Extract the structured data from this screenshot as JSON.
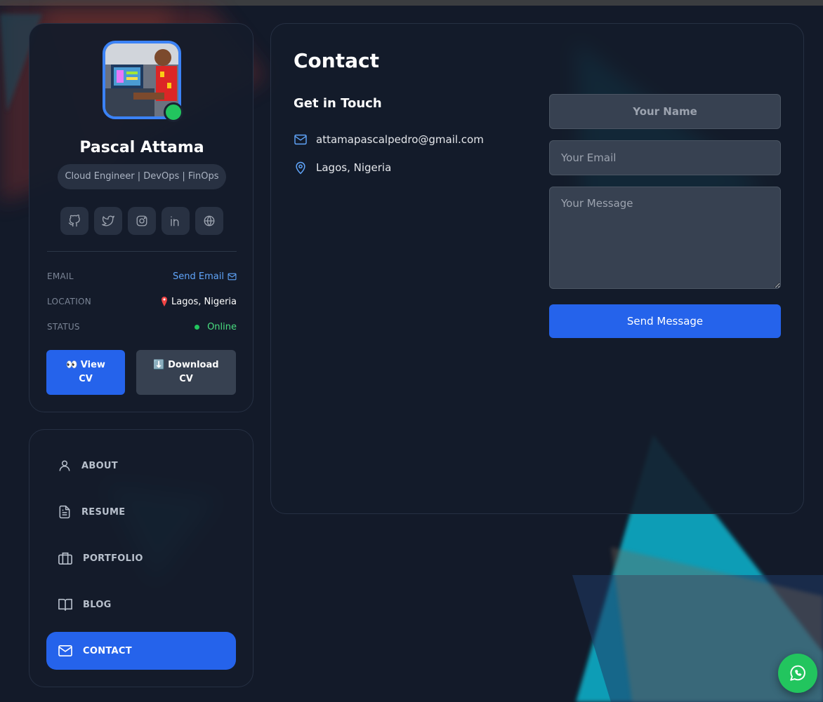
{
  "profile": {
    "name": "Pascal Attama",
    "role": "Cloud Engineer | DevOps | FinOps",
    "socials": [
      {
        "icon": "github-icon"
      },
      {
        "icon": "twitter-icon"
      },
      {
        "icon": "instagram-icon"
      },
      {
        "icon": "linkedin-icon"
      },
      {
        "icon": "globe-icon"
      }
    ],
    "info": {
      "email_label": "EMAIL",
      "email_value": "Send Email",
      "location_label": "LOCATION",
      "location_value": "Lagos, Nigeria",
      "status_label": "STATUS",
      "status_value": "Online"
    },
    "buttons": {
      "view_cv": "👀 View CV",
      "download_cv": "⬇️ Download CV"
    }
  },
  "nav": {
    "items": [
      {
        "label": "ABOUT",
        "icon": "user-icon"
      },
      {
        "label": "RESUME",
        "icon": "document-icon"
      },
      {
        "label": "PORTFOLIO",
        "icon": "briefcase-icon"
      },
      {
        "label": "BLOG",
        "icon": "book-icon"
      },
      {
        "label": "CONTACT",
        "icon": "mail-icon",
        "active": true
      }
    ]
  },
  "contact": {
    "title": "Contact",
    "subtitle": "Get in Touch",
    "email": "attamapascalpedro@gmail.com",
    "location": "Lagos, Nigeria",
    "form": {
      "name_placeholder": "Your Name",
      "email_placeholder": "Your Email",
      "message_placeholder": "Your Message",
      "submit_label": "Send Message"
    }
  },
  "colors": {
    "accent": "#2563eb",
    "online": "#22c55e",
    "background": "#131a29",
    "panel": "#141c2a"
  },
  "whatsapp": {
    "icon": "whatsapp-icon"
  }
}
